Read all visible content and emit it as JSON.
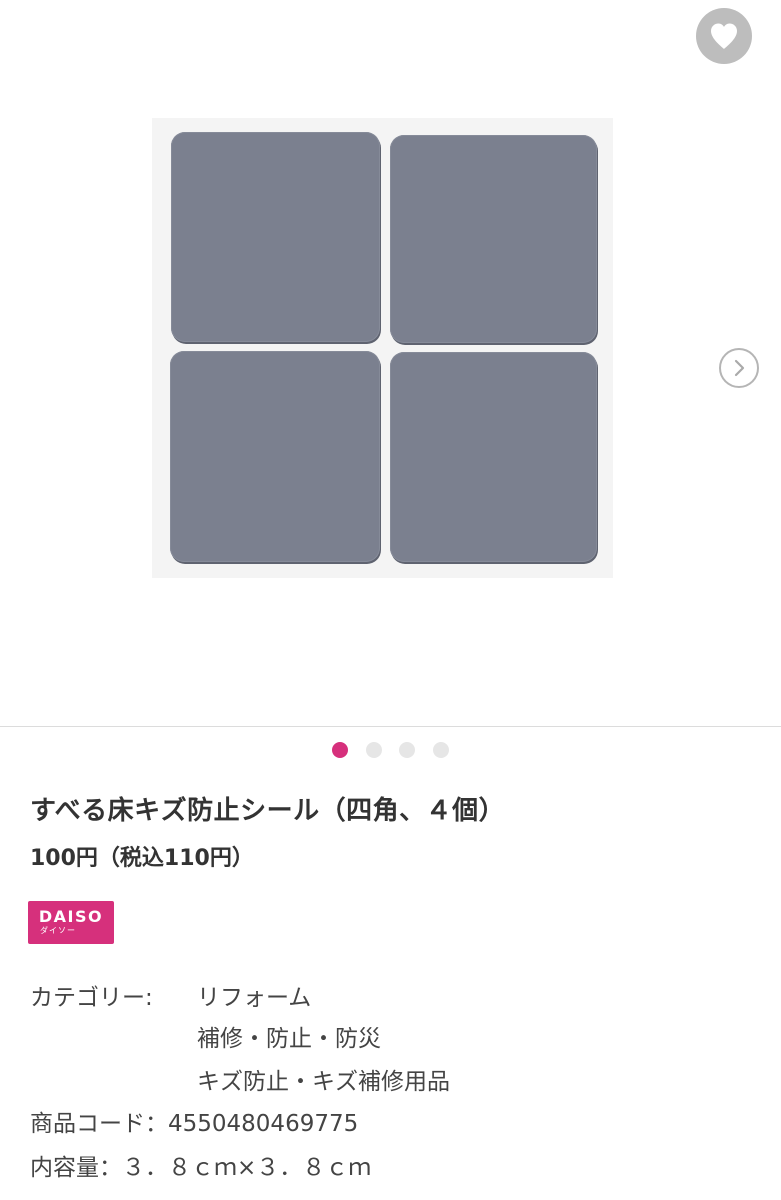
{
  "gallery": {
    "favorite_icon": "heart-icon",
    "next_icon": "chevron-right-icon",
    "image_count": 4,
    "active_index": 0,
    "accent_color": "#d6307c"
  },
  "product": {
    "title": "すべる床キズ防止シール（四角、４個）",
    "price": "100円（税込110円）"
  },
  "brand": {
    "logo_main": "DAISO",
    "logo_sub": "ダイソー",
    "color": "#d6307c"
  },
  "details": {
    "category_label": "カテゴリー:",
    "categories": [
      "リフォーム",
      "補修・防止・防災",
      "キズ防止・キズ補修用品"
    ],
    "code_label": "商品コード：",
    "code_value": "4550480469775",
    "size_label": "内容量：",
    "size_value": "３．８ｃｍ×３．８ｃｍ"
  }
}
